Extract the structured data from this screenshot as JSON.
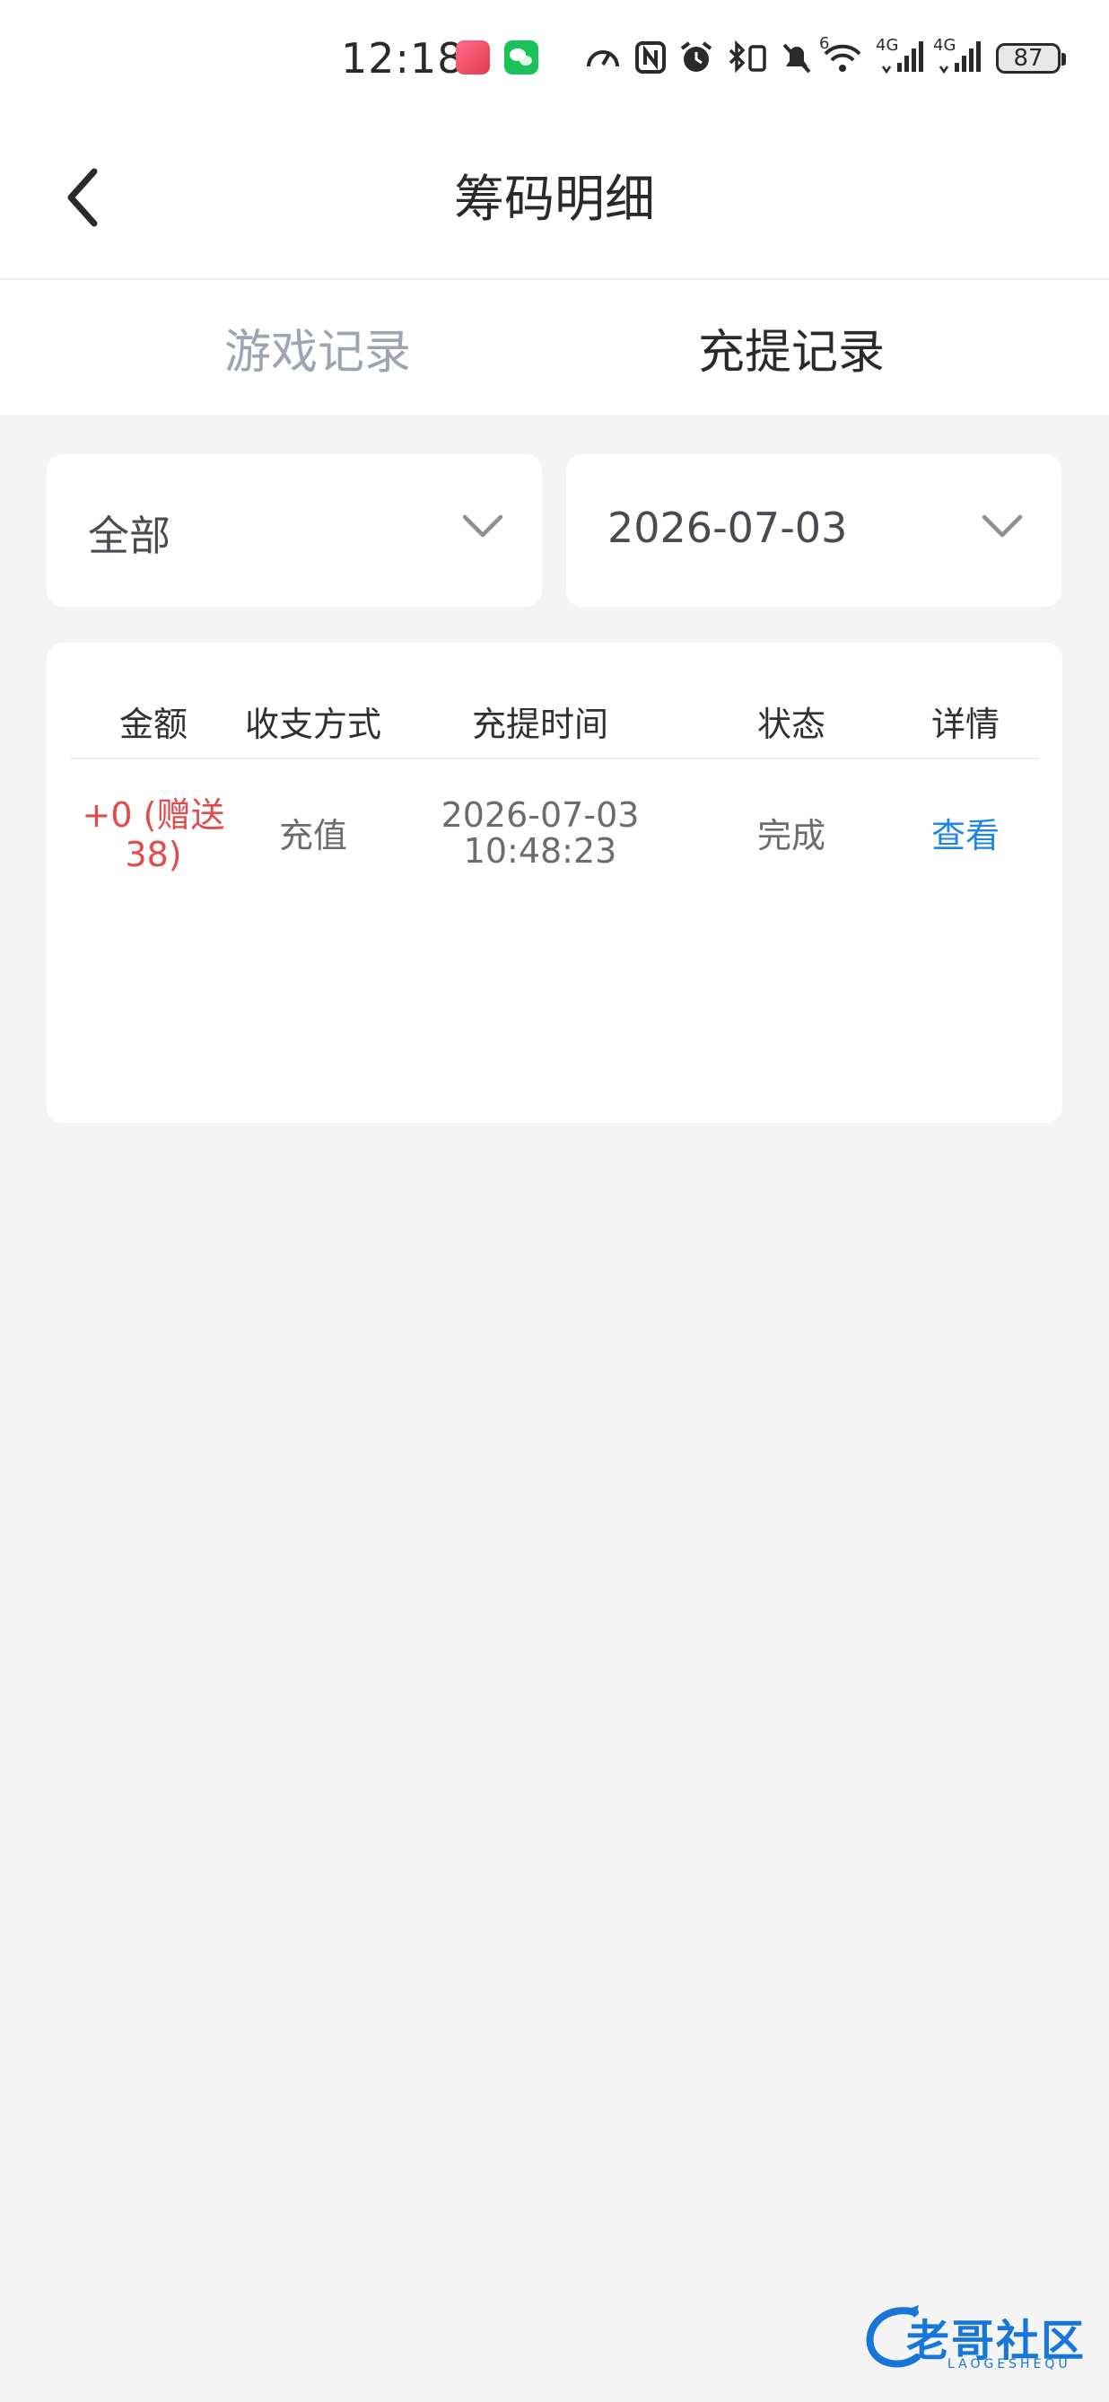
{
  "status_bar": {
    "time": "12:18",
    "battery": "87",
    "network_1": "4G",
    "network_2": "4G",
    "wifi_badge": "6"
  },
  "header": {
    "title": "筹码明细"
  },
  "tabs": [
    {
      "label": "游戏记录",
      "active": false
    },
    {
      "label": "充提记录",
      "active": true
    }
  ],
  "filters": {
    "type": "全部",
    "date": "2026-07-03"
  },
  "table": {
    "columns": [
      "金额",
      "收支方式",
      "充提时间",
      "状态",
      "详情"
    ],
    "rows": [
      {
        "amount_line1": "+0 (赠送",
        "amount_line2": "38)",
        "method": "充值",
        "date": "2026-07-03",
        "time": "10:48:23",
        "status": "完成",
        "detail": "查看"
      }
    ]
  },
  "watermark": {
    "text": "老哥社区",
    "sub": "LAOGESHEQU"
  },
  "colors": {
    "background": "#f4f4f5",
    "amount_red": "#e34b4b",
    "link_blue": "#1f86e4",
    "tab_inactive": "#9ea4b4"
  }
}
